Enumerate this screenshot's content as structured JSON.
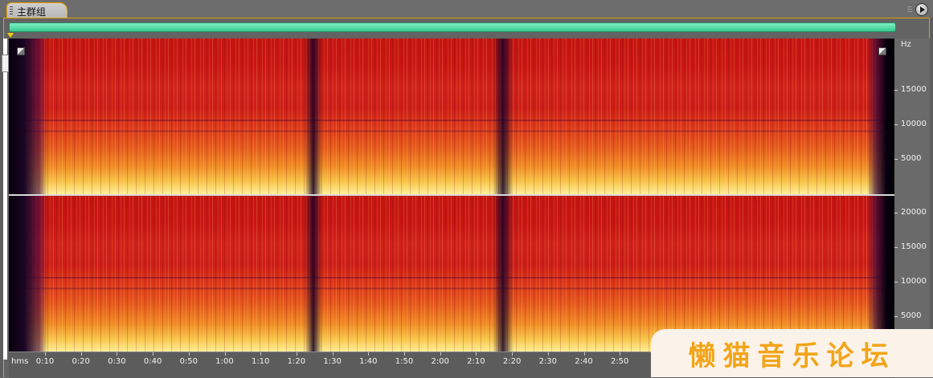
{
  "panel": {
    "tab_label": "主群组"
  },
  "frequency_ruler": {
    "unit": "Hz",
    "channel1": [
      "15000",
      "10000",
      "5000"
    ],
    "channel2": [
      "20000",
      "15000",
      "10000",
      "5000"
    ]
  },
  "time_ruler": {
    "format": "hms",
    "ticks": [
      "0:10",
      "0:20",
      "0:30",
      "0:40",
      "0:50",
      "1:00",
      "1:10",
      "1:20",
      "1:30",
      "1:40",
      "1:50",
      "2:00",
      "2:10",
      "2:20",
      "2:30",
      "2:40",
      "2:50",
      "3:"
    ]
  },
  "watermark": {
    "text": "懒猫音乐论坛"
  },
  "colors": {
    "overview_bar": "#4ee0a8",
    "accent_border": "#e0a000",
    "spectral_low": "#c51511",
    "spectral_high": "#fff09a"
  }
}
